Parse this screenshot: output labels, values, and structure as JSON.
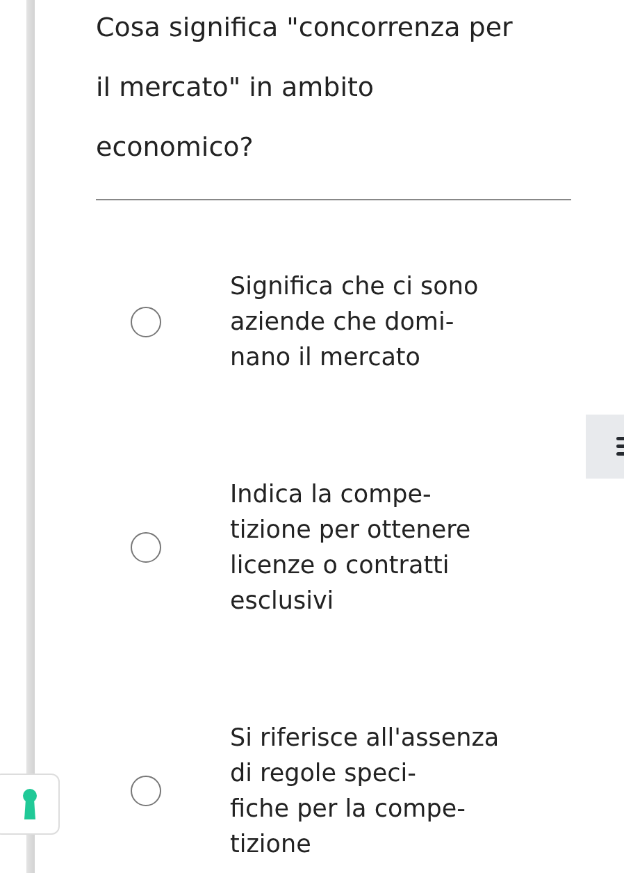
{
  "question": {
    "lines": [
      "Cosa significa \"concorrenza per",
      "il mercato\" in ambito",
      "economico?"
    ]
  },
  "options": [
    {
      "lines": [
        "Significa che ci sono",
        "aziende che domi-",
        "nano il mercato"
      ],
      "selected": false
    },
    {
      "lines": [
        "Indica la compe-",
        "tizione per ottenere",
        "licenze o contratti",
        "esclusivi"
      ],
      "selected": false
    },
    {
      "lines": [
        "Si riferisce all'assenza",
        "di regole speci-",
        "fiche per la compe-",
        "tizione"
      ],
      "selected": false
    }
  ]
}
